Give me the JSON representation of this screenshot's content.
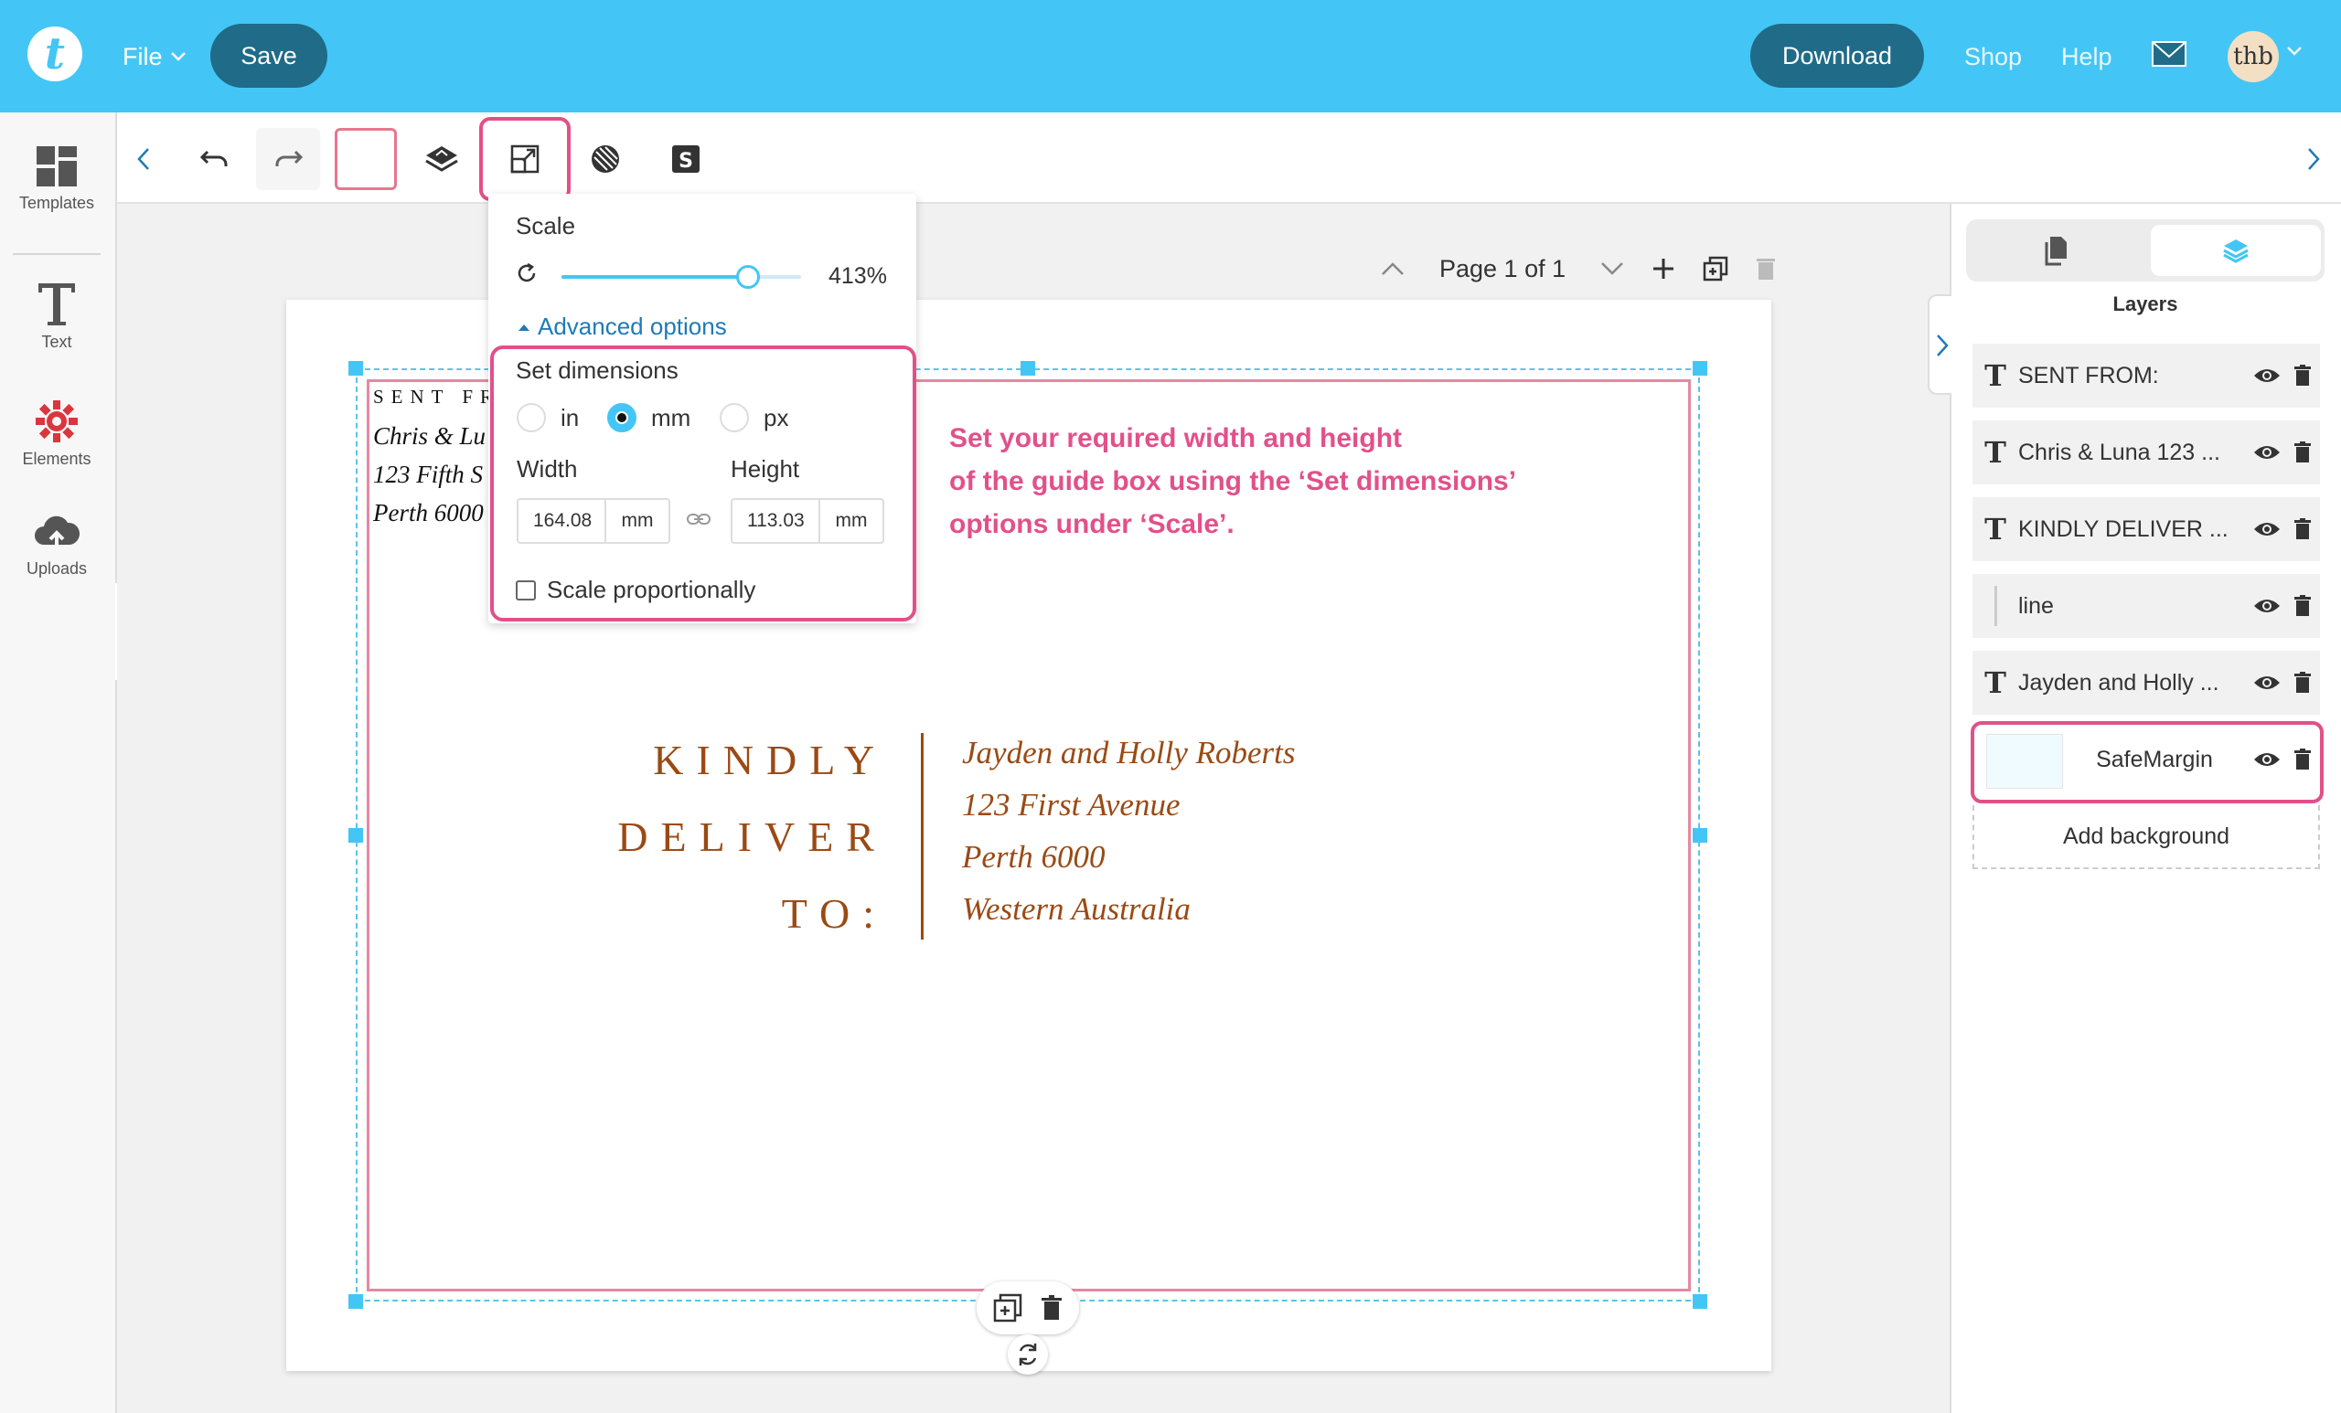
{
  "header": {
    "logo_letter": "t",
    "file_label": "File",
    "save_label": "Save",
    "download_label": "Download",
    "shop_label": "Shop",
    "help_label": "Help",
    "avatar_text": "thb",
    "accent_color": "#43c6f5",
    "button_color": "#1f6b88"
  },
  "sidebar": {
    "items": [
      {
        "label": "Templates",
        "icon": "templates-icon"
      },
      {
        "label": "Text",
        "icon": "text-icon"
      },
      {
        "label": "Elements",
        "icon": "elements-icon"
      },
      {
        "label": "Uploads",
        "icon": "uploads-icon"
      }
    ]
  },
  "toolbar": {
    "tools": [
      "back-icon",
      "undo-icon",
      "redo-icon",
      "color-swatch",
      "layer-order-icon",
      "scale-icon",
      "opacity-icon",
      "shop-tag-icon"
    ]
  },
  "page_nav": {
    "label": "Page 1 of 1"
  },
  "scale_popover": {
    "title": "Scale",
    "value_percent": 413,
    "value_label": "413%",
    "slider_fraction": 0.78,
    "advanced_label": "Advanced options",
    "dimensions_title": "Set dimensions",
    "units": [
      {
        "label": "in",
        "selected": false
      },
      {
        "label": "mm",
        "selected": true
      },
      {
        "label": "px",
        "selected": false
      }
    ],
    "width_label": "Width",
    "height_label": "Height",
    "width_value": "164.08",
    "height_value": "113.03",
    "unit_label": "mm",
    "scale_prop_label": "Scale proportionally",
    "scale_prop_checked": false
  },
  "canvas": {
    "sent_from": "SENT FR",
    "sender_lines": [
      "Chris & Lu",
      "123 Fifth S",
      "Perth 6000"
    ],
    "kindly_lines": [
      "KINDLY",
      "DELIVER",
      "TO:"
    ],
    "recipient_lines": [
      "Jayden and Holly Roberts",
      "123 First Avenue",
      "Perth 6000",
      "Western Australia"
    ],
    "hint_lines": [
      "Set your required width and height",
      "of the guide box using the ‘Set dimensions’",
      "options under ‘Scale’."
    ],
    "text_color": "#9a4a14",
    "hint_color": "#e2508a"
  },
  "right_panel": {
    "layers_title": "Layers",
    "layers": [
      {
        "name": "SENT FROM:",
        "type": "text"
      },
      {
        "name": "Chris & Luna 123 ...",
        "type": "text"
      },
      {
        "name": "KINDLY DELIVER ...",
        "type": "text"
      },
      {
        "name": "line",
        "type": "line"
      },
      {
        "name": "Jayden and Holly ...",
        "type": "text"
      },
      {
        "name": "SafeMargin",
        "type": "shape"
      }
    ],
    "add_background_label": "Add background"
  }
}
